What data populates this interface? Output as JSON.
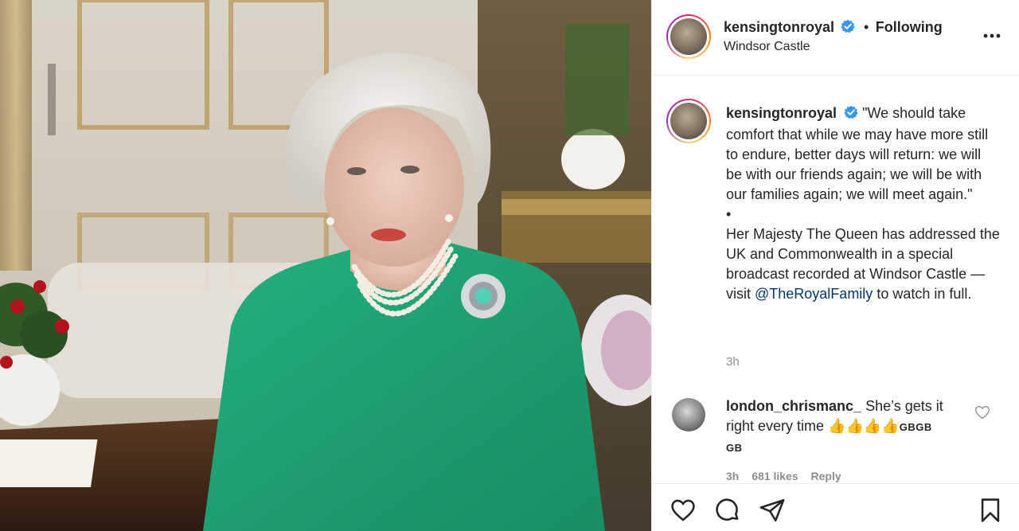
{
  "post": {
    "username": "kensingtonroyal",
    "verified": true,
    "follow_status": "Following",
    "separator": "•",
    "location": "Windsor Castle",
    "caption": {
      "username": "kensingtonroyal",
      "quote": "\"We should take comfort that while we may have more still to endure, better days will return: we will be with our friends again; we will be with our families again; we will meet again.\"",
      "bullet": "•",
      "text_before_mention": "Her Majesty The Queen has addressed the UK and Commonwealth in a special broadcast recorded at Windsor Castle — visit ",
      "mention": "@TheRoyalFamily",
      "text_after_mention": " to watch in full."
    },
    "timestamp": "3h"
  },
  "comment": {
    "username": "london_chrismanc_",
    "text": "She’s gets it right every time",
    "emoji": "👍👍👍👍",
    "gb_inline": "GBGB",
    "gb_line": "GB",
    "time": "3h",
    "likes": "681 likes",
    "reply": "Reply"
  },
  "icons": {
    "verified": "verified-badge-icon",
    "more": "more-options-icon",
    "comment_like": "heart-outline-icon",
    "like": "heart-icon",
    "comment": "comment-bubble-icon",
    "share": "paper-plane-icon",
    "save": "bookmark-icon"
  },
  "colors": {
    "verified_blue": "#3897f0",
    "mention_blue": "#00376b",
    "muted_gray": "#8e8e8e",
    "dress_green": "#1fa774"
  }
}
